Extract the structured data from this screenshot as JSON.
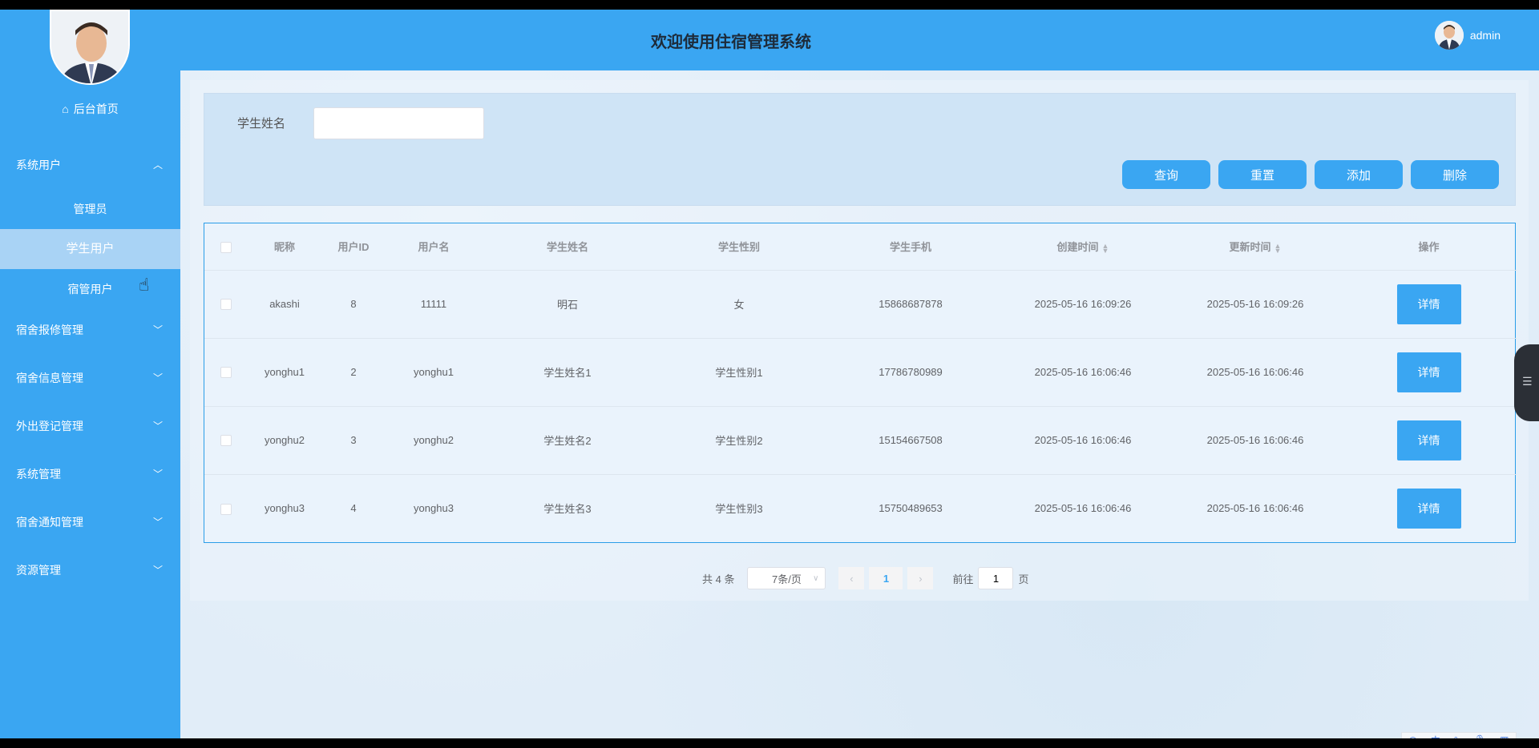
{
  "sidebar": {
    "home_label": "后台首页",
    "menus": [
      {
        "label": "系统用户",
        "expanded": true
      },
      {
        "label": "宿舍报修管理"
      },
      {
        "label": "宿舍信息管理"
      },
      {
        "label": "外出登记管理"
      },
      {
        "label": "系统管理"
      },
      {
        "label": "宿舍通知管理"
      },
      {
        "label": "资源管理"
      }
    ],
    "sub_items": [
      {
        "label": "管理员"
      },
      {
        "label": "学生用户",
        "active": true
      },
      {
        "label": "宿管用户"
      }
    ]
  },
  "header": {
    "title": "欢迎使用住宿管理系统",
    "username": "admin"
  },
  "search": {
    "label": "学生姓名",
    "value": "",
    "buttons": {
      "query": "查询",
      "reset": "重置",
      "add": "添加",
      "delete": "删除"
    }
  },
  "table": {
    "columns": [
      "昵称",
      "用户ID",
      "用户名",
      "学生姓名",
      "学生性别",
      "学生手机",
      "创建时间",
      "更新时间",
      "操作"
    ],
    "detail_label": "详情",
    "rows": [
      {
        "nickname": "akashi",
        "id": "8",
        "username": "11111",
        "name": "明石",
        "gender": "女",
        "phone": "15868687878",
        "created": "2025-05-16 16:09:26",
        "updated": "2025-05-16 16:09:26"
      },
      {
        "nickname": "yonghu1",
        "id": "2",
        "username": "yonghu1",
        "name": "学生姓名1",
        "gender": "学生性别1",
        "phone": "17786780989",
        "created": "2025-05-16 16:06:46",
        "updated": "2025-05-16 16:06:46"
      },
      {
        "nickname": "yonghu2",
        "id": "3",
        "username": "yonghu2",
        "name": "学生姓名2",
        "gender": "学生性别2",
        "phone": "15154667508",
        "created": "2025-05-16 16:06:46",
        "updated": "2025-05-16 16:06:46"
      },
      {
        "nickname": "yonghu3",
        "id": "4",
        "username": "yonghu3",
        "name": "学生姓名3",
        "gender": "学生性别3",
        "phone": "15750489653",
        "created": "2025-05-16 16:06:46",
        "updated": "2025-05-16 16:06:46"
      }
    ]
  },
  "pagination": {
    "total": "共 4 条",
    "page_size": "7条/页",
    "current_page": "1",
    "goto_prefix": "前往",
    "goto_value": "1",
    "goto_suffix": "页"
  },
  "ime": {
    "lang": "中"
  },
  "colors": {
    "primary": "#3aa6f2",
    "active_sub": "#a9d3f5",
    "table_border": "#2a9de8"
  }
}
